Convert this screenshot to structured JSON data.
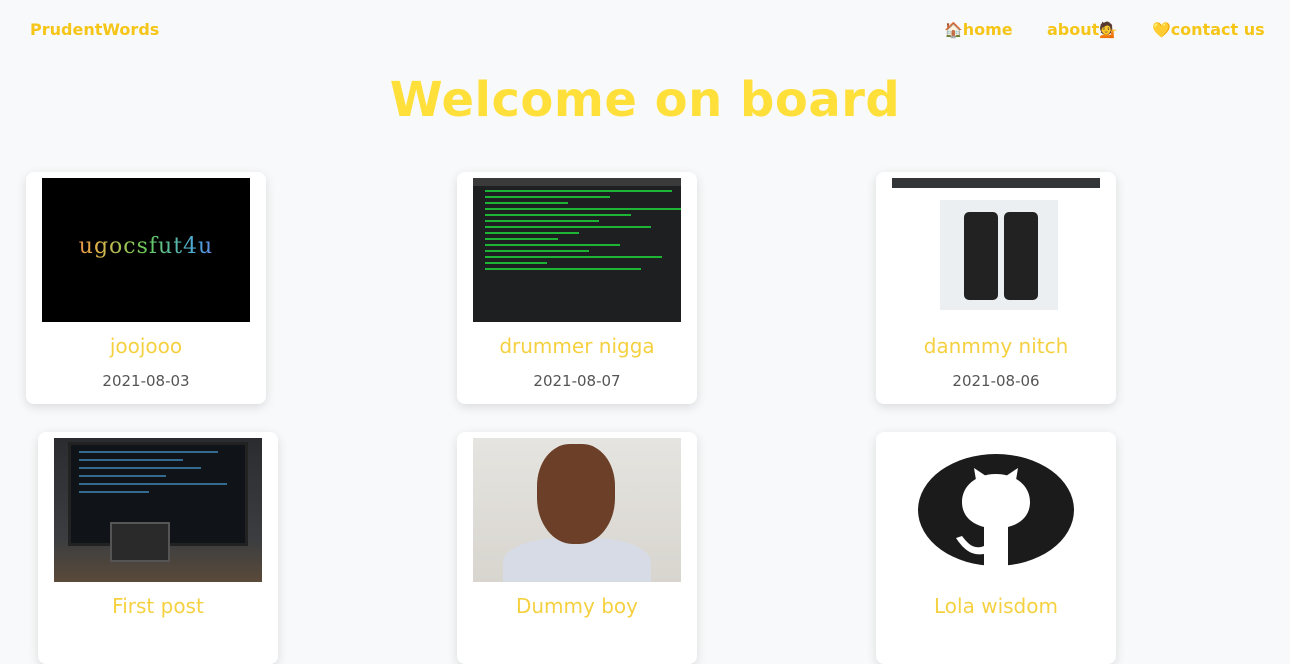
{
  "nav": {
    "brand": "PrudentWords",
    "home": {
      "emoji": "🏠",
      "label": "home"
    },
    "about": {
      "label": "about",
      "emoji": "💁"
    },
    "contact": {
      "emoji": "💛",
      "label": "contact us"
    }
  },
  "hero": {
    "title": "Welcome on board"
  },
  "colors": {
    "accent": "#f5c518",
    "title": "#ffdf3a",
    "card_title": "#f5d142"
  },
  "posts": [
    {
      "title": "joojooo",
      "date": "2021-08-03",
      "image": "logo-on-black"
    },
    {
      "title": "drummer nigga",
      "date": "2021-08-07",
      "image": "terminal-screenshot"
    },
    {
      "title": "danmmy nitch",
      "date": "2021-08-06",
      "image": "browser-screenshot"
    },
    {
      "title": "First post",
      "date": "",
      "image": "desk-setup-photo"
    },
    {
      "title": "Dummy boy",
      "date": "",
      "image": "portrait-photo"
    },
    {
      "title": "Lola wisdom",
      "date": "",
      "image": "github-logo"
    }
  ]
}
